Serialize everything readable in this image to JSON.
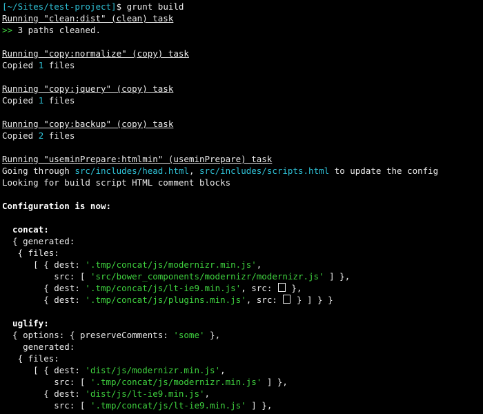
{
  "prompt": {
    "path": "[~/Sites/test-project]",
    "symbol": "$",
    "command": " grunt build"
  },
  "tasks": [
    {
      "running": "Running \"clean:dist\" (clean) task"
    },
    {
      "running": "Running \"copy:normalize\" (copy) task"
    },
    {
      "running": "Running \"copy:jquery\" (copy) task"
    },
    {
      "running": "Running \"copy:backup\" (copy) task"
    },
    {
      "running": "Running \"useminPrepare:htmlmin\" (useminPrepare) task"
    }
  ],
  "clean": {
    "marker": ">>",
    "text": " 3 paths cleaned."
  },
  "copy": {
    "prefix": "Copied ",
    "suffix": " files",
    "counts": [
      "1",
      "1",
      "2"
    ]
  },
  "usemin": {
    "going_through": "Going through ",
    "file1": "src/includes/head.html",
    "sep": ", ",
    "file2": "src/includes/scripts.html",
    "to_update": " to update the config",
    "looking": "Looking for build script HTML comment blocks"
  },
  "config_header": "Configuration is now:",
  "concat": {
    "key": "  concat:",
    "generated": "  { generated:",
    "files": "   { files:",
    "l1_pre": "      [ { dest: ",
    "l1_val": "'.tmp/concat/js/modernizr.min.js'",
    "l1_post": ",",
    "l2_pre": "          src: [ ",
    "l2_val": "'src/bower_components/modernizr/modernizr.js'",
    "l2_post": " ] },",
    "l3_pre": "        { dest: ",
    "l3_val": "'.tmp/concat/js/lt-ie9.min.js'",
    "l3_mid": ", src: ",
    "l3_post": " },",
    "l4_pre": "        { dest: ",
    "l4_val": "'.tmp/concat/js/plugins.min.js'",
    "l4_mid": ", src: ",
    "l4_post": " } ] } }"
  },
  "uglify": {
    "key": "  uglify:",
    "options_pre": "  { options: { preserveComments: ",
    "options_val": "'some'",
    "options_post": " },",
    "generated": "    generated:",
    "files": "   { files:",
    "l1_pre": "      [ { dest: ",
    "l1_val": "'dist/js/modernizr.min.js'",
    "l1_post": ",",
    "l2_pre": "          src: [ ",
    "l2_val": "'.tmp/concat/js/modernizr.min.js'",
    "l2_post": " ] },",
    "l3_pre": "        { dest: ",
    "l3_val": "'dist/js/lt-ie9.min.js'",
    "l3_post": ",",
    "l4_pre": "          src: [ ",
    "l4_val": "'.tmp/concat/js/lt-ie9.min.js'",
    "l4_post": " ] },"
  },
  "colors": {
    "background": "#000000",
    "text": "#ececec",
    "green": "#3fd33f",
    "cyan": "#2fc1d6"
  }
}
